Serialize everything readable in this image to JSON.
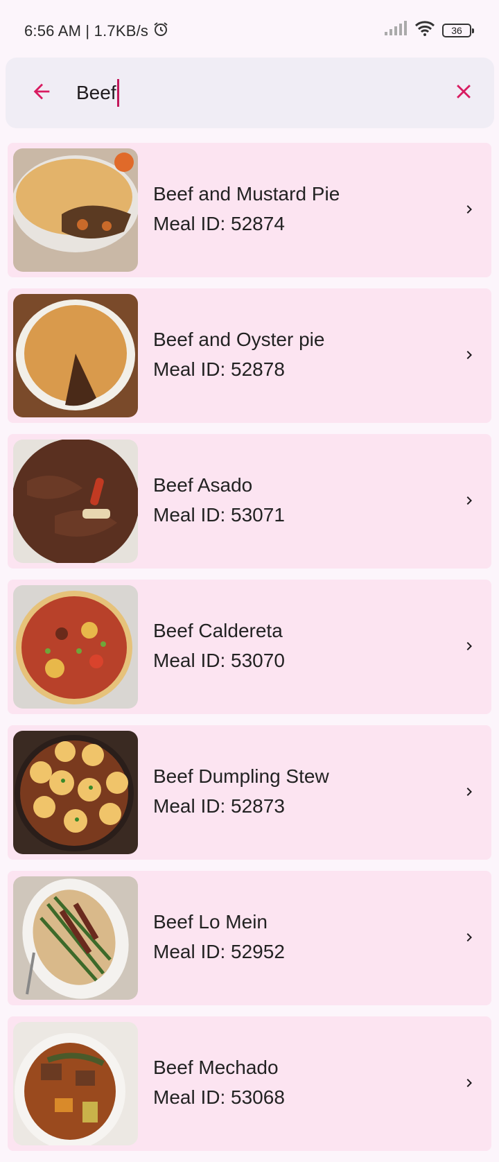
{
  "status_bar": {
    "time_speed": "6:56 AM | 1.7KB/s",
    "battery": "36"
  },
  "search": {
    "query": "Beef"
  },
  "meals": [
    {
      "name": "Beef and Mustard Pie",
      "id_text": "Meal ID: 52874",
      "thumb": "pie"
    },
    {
      "name": "Beef and Oyster pie",
      "id_text": "Meal ID: 52878",
      "thumb": "pie2"
    },
    {
      "name": "Beef Asado",
      "id_text": "Meal ID: 53071",
      "thumb": "stew"
    },
    {
      "name": "Beef Caldereta",
      "id_text": "Meal ID: 53070",
      "thumb": "caldereta"
    },
    {
      "name": "Beef Dumpling Stew",
      "id_text": "Meal ID: 52873",
      "thumb": "dumpling"
    },
    {
      "name": "Beef Lo Mein",
      "id_text": "Meal ID: 52952",
      "thumb": "lomein"
    },
    {
      "name": "Beef Mechado",
      "id_text": "Meal ID: 53068",
      "thumb": "mechado"
    }
  ],
  "colors": {
    "accent": "#d81b60",
    "card": "#fce4f1",
    "search_bg": "#f0edf5"
  }
}
